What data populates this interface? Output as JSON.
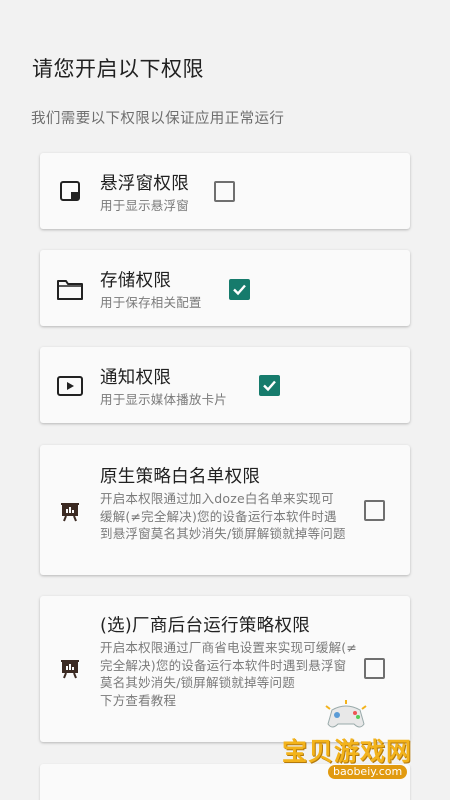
{
  "header": {
    "title": "请您开启以下权限",
    "subtitle": "我们需要以下权限以保证应用正常运行"
  },
  "permissions": [
    {
      "title": "悬浮窗权限",
      "desc": "用于显示悬浮窗",
      "checked": false,
      "icon": "floating-window-icon"
    },
    {
      "title": "存储权限",
      "desc": "用于保存相关配置",
      "checked": true,
      "icon": "folder-icon"
    },
    {
      "title": "通知权限",
      "desc": "用于显示媒体播放卡片",
      "checked": true,
      "icon": "play-icon"
    },
    {
      "title": "原生策略白名单权限",
      "desc": "开启本权限通过加入doze白名单来实现可缓解(≠完全解决)您的设备运行本软件时遇到悬浮窗莫名其妙消失/锁屏解锁就掉等问题",
      "checked": false,
      "icon": "presentation-icon"
    },
    {
      "title": "(选)厂商后台运行策略权限",
      "desc": "开启本权限通过厂商省电设置来实现可缓解(≠完全解决)您的设备运行本软件时遇到悬浮窗莫名其妙消失/锁屏解锁就掉等问题\n下方查看教程",
      "checked": false,
      "icon": "presentation-icon"
    }
  ],
  "colors": {
    "accent": "#167b6c",
    "background": "#f2f2f2",
    "card": "#fafafa"
  },
  "watermark": {
    "name": "宝贝游戏网",
    "url": "baobeiy.com"
  }
}
